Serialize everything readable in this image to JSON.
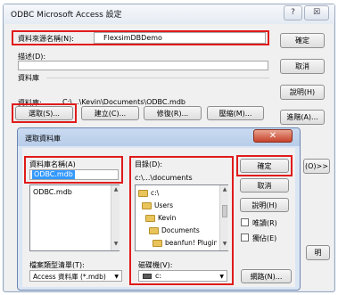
{
  "main_window": {
    "title": "ODBC Microsoft Access 設定",
    "help_button": "?",
    "close_button": "☒",
    "dsn_label": "資料來源名稱(N):",
    "dsn_value": "FlexsimDBDemo",
    "desc_label": "描述(D):",
    "db_group_label": "資料庫",
    "db_path_label": "資料庫:",
    "db_path_value": "C:\\...\\Kevin\\Documents\\ODBC.mdb",
    "buttons": {
      "select": "選取(S)...",
      "create": "建立(C)...",
      "repair": "修復(R)...",
      "compact": "壓縮(M)...",
      "ok": "確定",
      "cancel": "取消",
      "help": "說明(H)",
      "advanced": "進階(A)...",
      "options": "(O)>>",
      "partial_right": "明"
    }
  },
  "select_dialog": {
    "title": "選取資料庫",
    "close_glyph": "✕",
    "db_name_label": "資料庫名稱(A)",
    "db_name_value": "ODBC.mdb",
    "files": [
      "ODBC.mdb"
    ],
    "dir_label": "目錄(D):",
    "dir_value": "c:\\...\\documents",
    "dirs": [
      "c:\\",
      "Users",
      "Kevin",
      "Documents",
      "beanfun! Plugin"
    ],
    "file_type_label": "檔案類型清單(T):",
    "file_type_value": "Access 資料庫 (*.mdb)",
    "drive_label": "磁碟機(V):",
    "drive_value": "c:",
    "buttons": {
      "ok": "確定",
      "cancel": "取消",
      "help": "說明(H)",
      "network": "網路(N)..."
    },
    "checkboxes": {
      "readonly": "唯讀(R)",
      "exclusive": "獨佔(E)"
    }
  },
  "colors": {
    "highlight": "#e01b1b",
    "selection": "#3399ff",
    "dialog_frame": "#dbe6f4"
  }
}
